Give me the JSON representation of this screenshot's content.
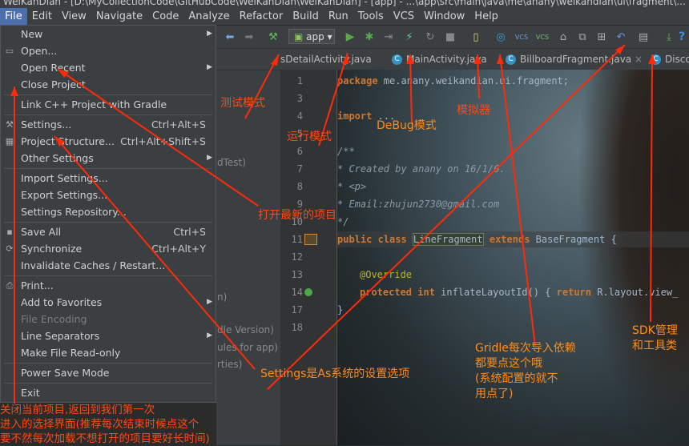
{
  "window": {
    "title": "WeiKanDian - [D:\\MyCollectionCode\\GitHubCode\\WeiKanDian\\WeiKanDian] - [app] - ...\\app\\src\\main\\java\\me\\anany\\weikandian\\ui\\fragment\\..."
  },
  "menubar": [
    "File",
    "Edit",
    "View",
    "Navigate",
    "Code",
    "Analyze",
    "Refactor",
    "Build",
    "Run",
    "Tools",
    "VCS",
    "Window",
    "Help"
  ],
  "toolbar": {
    "run_config": "app"
  },
  "tabs": [
    "sDetailActivity.java",
    "MainActivity.java",
    "BillboardFragment.java",
    "Disco"
  ],
  "file_menu": [
    {
      "label": "New",
      "submenu": true
    },
    {
      "label": "Open...",
      "icon": "folder-icon"
    },
    {
      "label": "Open Recent",
      "submenu": true
    },
    {
      "label": "Close Project"
    },
    {
      "sep": true
    },
    {
      "label": "Link C++ Project with Gradle"
    },
    {
      "sep": true
    },
    {
      "label": "Settings...",
      "shortcut": "Ctrl+Alt+S",
      "icon": "wrench-icon"
    },
    {
      "label": "Project Structure...",
      "shortcut": "Ctrl+Alt+Shift+S",
      "icon": "structure-icon"
    },
    {
      "label": "Other Settings",
      "submenu": true
    },
    {
      "sep": true
    },
    {
      "label": "Import Settings..."
    },
    {
      "label": "Export Settings..."
    },
    {
      "label": "Settings Repository..."
    },
    {
      "sep": true
    },
    {
      "label": "Save All",
      "shortcut": "Ctrl+S",
      "icon": "save-icon"
    },
    {
      "label": "Synchronize",
      "shortcut": "Ctrl+Alt+Y",
      "icon": "sync-icon"
    },
    {
      "label": "Invalidate Caches / Restart..."
    },
    {
      "sep": true
    },
    {
      "label": "Print...",
      "icon": "print-icon"
    },
    {
      "label": "Add to Favorites",
      "submenu": true
    },
    {
      "label": "File Encoding",
      "disabled": true
    },
    {
      "label": "Line Separators",
      "submenu": true
    },
    {
      "label": "Make File Read-only"
    },
    {
      "sep": true
    },
    {
      "label": "Power Save Mode"
    },
    {
      "sep": true
    },
    {
      "label": "Exit"
    }
  ],
  "bg_texts": [
    "dTest)",
    "n)",
    "dle Version)",
    "ules for app)",
    "rties)"
  ],
  "line_numbers": [
    "1",
    "3",
    "4",
    "5",
    "6",
    "7",
    "8",
    "9",
    "10",
    "11",
    "12",
    "13",
    "14",
    "17",
    "18"
  ],
  "code": {
    "l1_kw": "package",
    "l1_rest": " me.anany.weikandian.ui.fragment;",
    "l4_kw": "import",
    "l4_rest": " ...",
    "l6": "/**",
    "l7": " * Created by anany on 16/1/6.",
    "l8": " * <p>",
    "l9": " * Email:zhujun2730@gmail.com",
    "l10": " */",
    "l11_kw": "public class ",
    "l11_cls": "LineFragment",
    "l11_ext": " extends ",
    "l11_base": "BaseFragment",
    "l11_end": " {",
    "l13": "@Override",
    "l14_kw": "protected int ",
    "l14_m": "inflateLayoutId",
    "l14_rest": "() { ",
    "l14_ret": "return ",
    "l14_end": "R.layout.view_",
    "l17": "}"
  },
  "annotations": {
    "test_mode": "测试模式",
    "run_mode": "运行模式",
    "debug_mode": "DeBug模式",
    "emulator": "模拟器",
    "open_recent": "打开最新的项目",
    "settings": "Settings是As系统的设置选项",
    "gradle": "Gridle每次导入依赖\n都要点这个哦\n(系统配置的就不\n用点了)",
    "sdk": "SDK管理\n和工具类",
    "close_project": "关闭当前项目,返回到我们第一次\n进入的选择界面(推荐每次结束时候点这个\n要不然每次加载不想打开的项目要好长时间)"
  },
  "colors": {
    "accent": "#ff4a12",
    "annotation_orange": "#ff8c1a",
    "menu_bg": "#3c3f41",
    "selected_menu": "#4b6eaf"
  }
}
